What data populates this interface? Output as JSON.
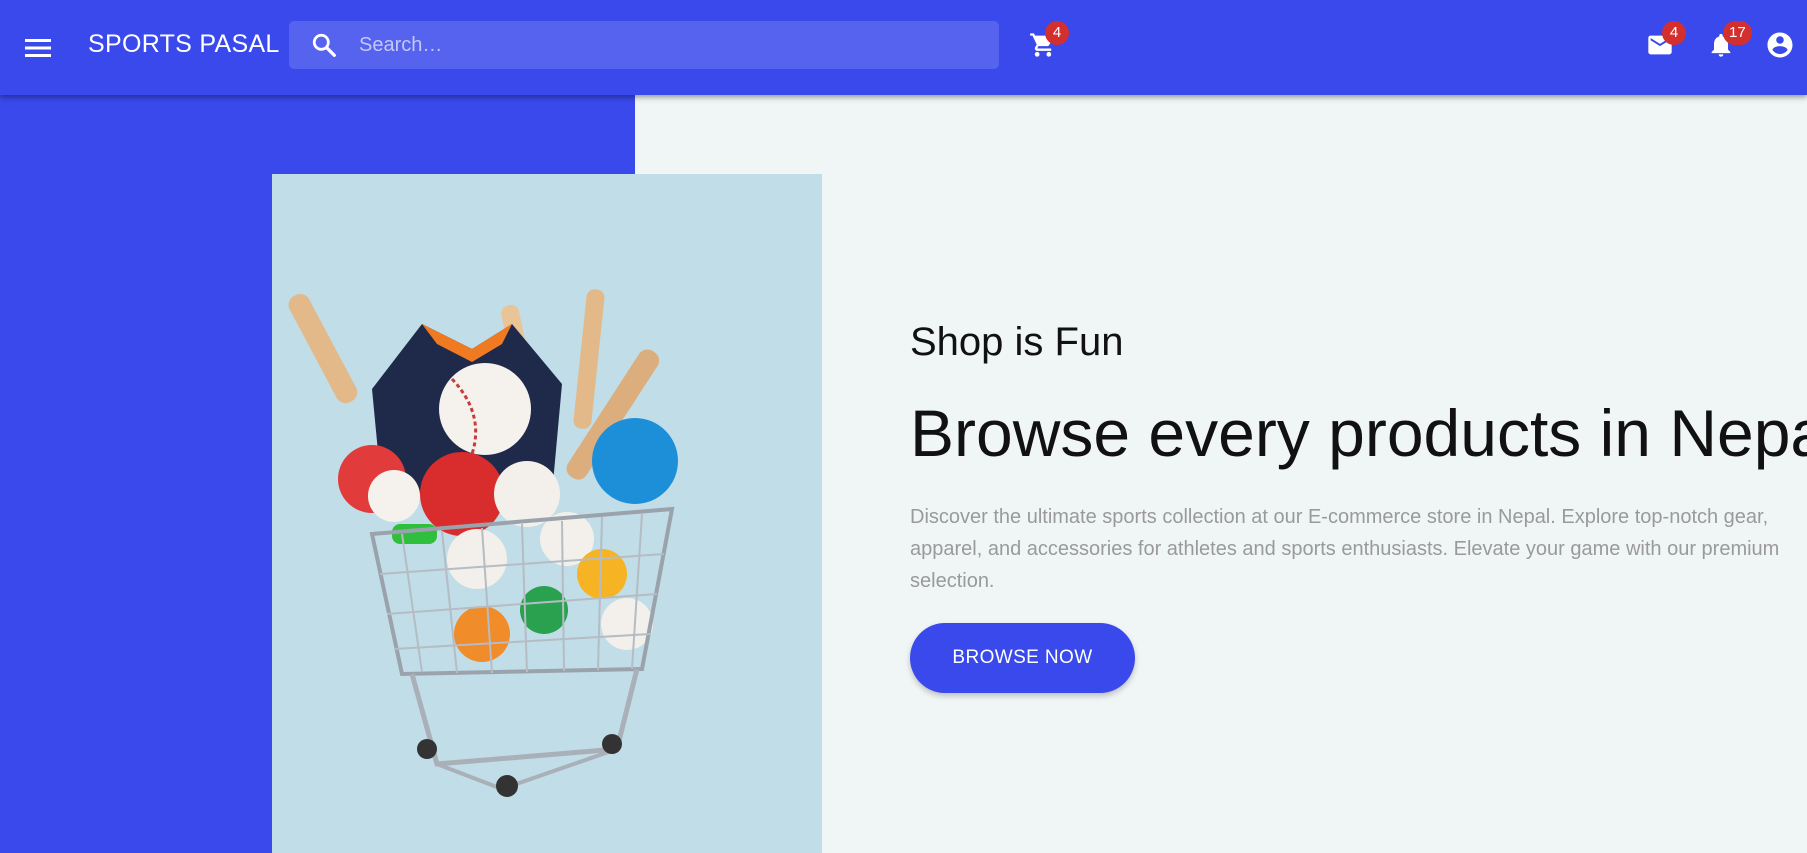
{
  "appbar": {
    "brand": "SPORTS PASAL",
    "search": {
      "placeholder": "Search…"
    },
    "cart_badge": "4",
    "mail_badge": "4",
    "notification_badge": "17",
    "icons": [
      "menu-icon",
      "search-icon",
      "cart-icon",
      "mail-icon",
      "bell-icon",
      "account-icon"
    ],
    "colors": {
      "primary": "#3a49ec",
      "badge": "#d32f2f"
    }
  },
  "hero": {
    "subtitle": "Shop is Fun",
    "headline": "Browse every products in Nepal",
    "description": "Discover the ultimate sports collection at our E-commerce store in Nepal. Explore top-notch gear, apparel, and accessories for athletes and sports enthusiasts. Elevate your game with our premium selection.",
    "button_label": "BROWSE NOW",
    "image_alt": "Shopping cart full of sports equipment"
  }
}
